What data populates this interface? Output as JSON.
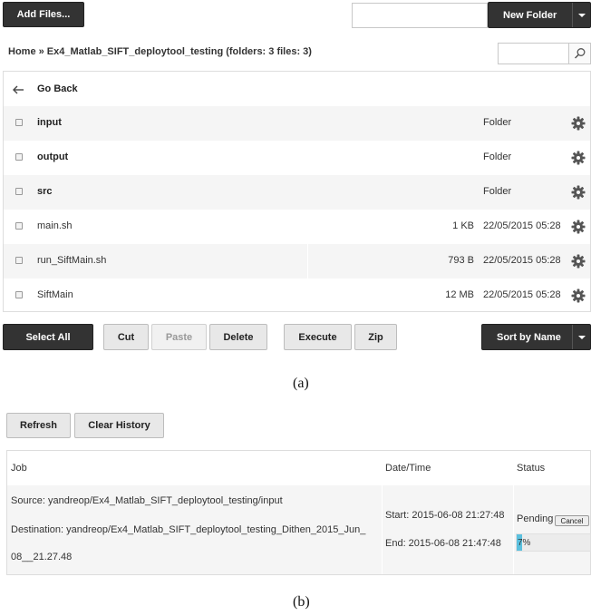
{
  "toolbar": {
    "add_files": "Add Files...",
    "new_folder_input": "",
    "new_folder": "New Folder"
  },
  "breadcrumb": "Home » Ex4_Matlab_SIFT_deploytool_testing (folders: 3 files: 3)",
  "search": {
    "value": ""
  },
  "go_back": "Go Back",
  "files": [
    {
      "name": "input",
      "size": "",
      "date": "Folder"
    },
    {
      "name": "output",
      "size": "",
      "date": "Folder"
    },
    {
      "name": "src",
      "size": "",
      "date": "Folder"
    },
    {
      "name": "main.sh",
      "size": "1 KB",
      "date": "22/05/2015 05:28"
    },
    {
      "name": "run_SiftMain.sh",
      "size": "793 B",
      "date": "22/05/2015 05:28"
    },
    {
      "name": "SiftMain",
      "size": "12 MB",
      "date": "22/05/2015 05:28"
    }
  ],
  "actions": {
    "select_all": "Select All",
    "cut": "Cut",
    "paste": "Paste",
    "delete": "Delete",
    "execute": "Execute",
    "zip": "Zip",
    "sort": "Sort by Name"
  },
  "captions": {
    "a": "(a)",
    "b": "(b)"
  },
  "history": {
    "refresh": "Refresh",
    "clear": "Clear History",
    "headers": {
      "job": "Job",
      "datetime": "Date/Time",
      "status": "Status"
    },
    "job": {
      "source": "Source: yandreop/Ex4_Matlab_SIFT_deploytool_testing/input",
      "destination_line1": "Destination: yandreop/Ex4_Matlab_SIFT_deploytool_testing_Dithen_2015_Jun_",
      "destination_line2": "08__21.27.48",
      "start": "Start: 2015-06-08 21:27:48",
      "end": "End: 2015-06-08 21:47:48",
      "status": "Pending",
      "cancel": "Cancel",
      "progress_percent": 7,
      "progress_label": "7%"
    }
  },
  "colors": {
    "dark_button": "#333333",
    "progress": "#5bc0de",
    "row_alt": "#f5f5f5"
  }
}
